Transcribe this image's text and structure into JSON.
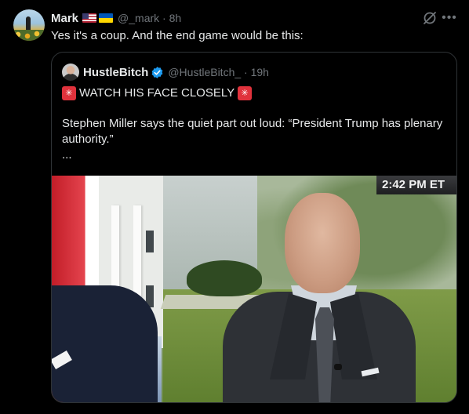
{
  "tweet": {
    "author_name": "Mark",
    "handle_time": "@_mark · 8h",
    "text": "Yes it's a coup. And the end game would be this:",
    "icons": {
      "avatar": "avatar-photo",
      "flags": [
        "us-flag",
        "ukraine-flag"
      ],
      "grok": "grok-icon",
      "more": "more-icon"
    }
  },
  "quoted": {
    "author_name": "HustleBitch",
    "handle_time": "@HustleBitch_ · 19h",
    "headline": "WATCH HIS FACE CLOSELY",
    "body": "Stephen Miller says the quiet part out loud: “President Trump has plenary authority.”",
    "more": "...",
    "video": {
      "timestamp": "2:42 PM ET"
    },
    "icons": {
      "verified": "verified-badge-icon",
      "siren": "police-light-icon"
    }
  },
  "colors": {
    "background": "#000000",
    "text": "#e7e9ea",
    "secondary": "#71767b",
    "border": "#2f3336",
    "verified": "#1d9bf0"
  }
}
